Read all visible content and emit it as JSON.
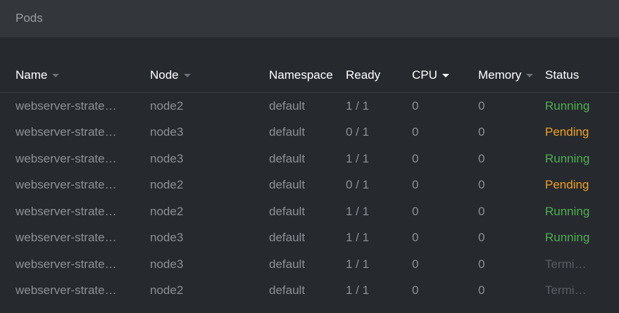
{
  "panel": {
    "title": "Pods"
  },
  "columns": [
    {
      "label": "Name",
      "sort": "caret"
    },
    {
      "label": "Node",
      "sort": "caret"
    },
    {
      "label": "Namespace",
      "sort": "none"
    },
    {
      "label": "Ready",
      "sort": "none"
    },
    {
      "label": "CPU",
      "sort": "caret-active"
    },
    {
      "label": "Memory",
      "sort": "caret"
    },
    {
      "label": "Status",
      "sort": "none"
    }
  ],
  "rows": [
    {
      "name": "webserver-strategy-rolling-update",
      "node": "node2",
      "namespace": "default",
      "ready": "1 / 1",
      "cpu": "0",
      "memory": "0",
      "status": "Running",
      "status_kind": "running"
    },
    {
      "name": "webserver-strategy-rolling-update",
      "node": "node3",
      "namespace": "default",
      "ready": "0 / 1",
      "cpu": "0",
      "memory": "0",
      "status": "Pending",
      "status_kind": "pending"
    },
    {
      "name": "webserver-strategy-rolling-update",
      "node": "node3",
      "namespace": "default",
      "ready": "1 / 1",
      "cpu": "0",
      "memory": "0",
      "status": "Running",
      "status_kind": "running"
    },
    {
      "name": "webserver-strategy-rolling-update",
      "node": "node2",
      "namespace": "default",
      "ready": "0 / 1",
      "cpu": "0",
      "memory": "0",
      "status": "Pending",
      "status_kind": "pending"
    },
    {
      "name": "webserver-strategy-rolling-update",
      "node": "node2",
      "namespace": "default",
      "ready": "1 / 1",
      "cpu": "0",
      "memory": "0",
      "status": "Running",
      "status_kind": "running"
    },
    {
      "name": "webserver-strategy-rolling-update",
      "node": "node3",
      "namespace": "default",
      "ready": "1 / 1",
      "cpu": "0",
      "memory": "0",
      "status": "Running",
      "status_kind": "running"
    },
    {
      "name": "webserver-strategy-rolling-update",
      "node": "node3",
      "namespace": "default",
      "ready": "1 / 1",
      "cpu": "0",
      "memory": "0",
      "status": "Terminating",
      "status_kind": "terminating"
    },
    {
      "name": "webserver-strategy-rolling-update",
      "node": "node2",
      "namespace": "default",
      "ready": "1 / 1",
      "cpu": "0",
      "memory": "0",
      "status": "Terminating",
      "status_kind": "terminating"
    }
  ],
  "colors": {
    "running": "#4fae4e",
    "pending": "#f0a020",
    "terminating": "#5a5e63",
    "background": "#262a2f",
    "header_bar": "#33363b"
  }
}
